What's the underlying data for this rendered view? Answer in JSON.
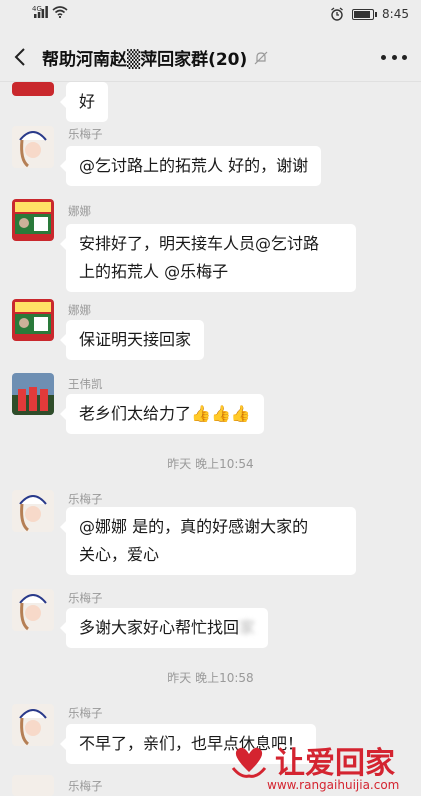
{
  "status_bar": {
    "network": "4G",
    "time": "8:45",
    "battery_level": 0.78
  },
  "header": {
    "title": "帮助河南赵▒萍回家群(20)",
    "back_icon": "chevron-left-icon",
    "mute_icon": "bell-off-icon",
    "more_icon": "more-dots-icon"
  },
  "messages": [
    {
      "sender": "",
      "text": "好"
    },
    {
      "sender": "乐梅子",
      "text": "@乞讨路上的拓荒人  好的，谢谢"
    },
    {
      "sender": "娜娜",
      "line1": "安排好了，明天接车人员@乞讨路",
      "line2": "上的拓荒人  @乐梅子"
    },
    {
      "sender": "娜娜",
      "text": "保证明天接回家"
    },
    {
      "sender": "王伟凯",
      "text": "老乡们太给力了",
      "emoji": "👍👍👍"
    },
    {
      "sender": "乐梅子",
      "line1": "@娜娜  是的，真的好感谢大家的",
      "line2": "关心，爱心"
    },
    {
      "sender": "乐梅子",
      "text": "多谢大家好心帮忙找回",
      "tail": "家"
    },
    {
      "sender": "乐梅子",
      "text": "不早了，亲们，也早点休息吧！"
    },
    {
      "sender": "乐梅子"
    }
  ],
  "timestamps": [
    "昨天 晚上10:54",
    "昨天 晚上10:58"
  ],
  "watermark": {
    "title": "让爱回家",
    "url": "www.rangaihuijia.com"
  },
  "colors": {
    "background": "#ededed",
    "bubble": "#ffffff",
    "brand_red": "#d42430"
  }
}
